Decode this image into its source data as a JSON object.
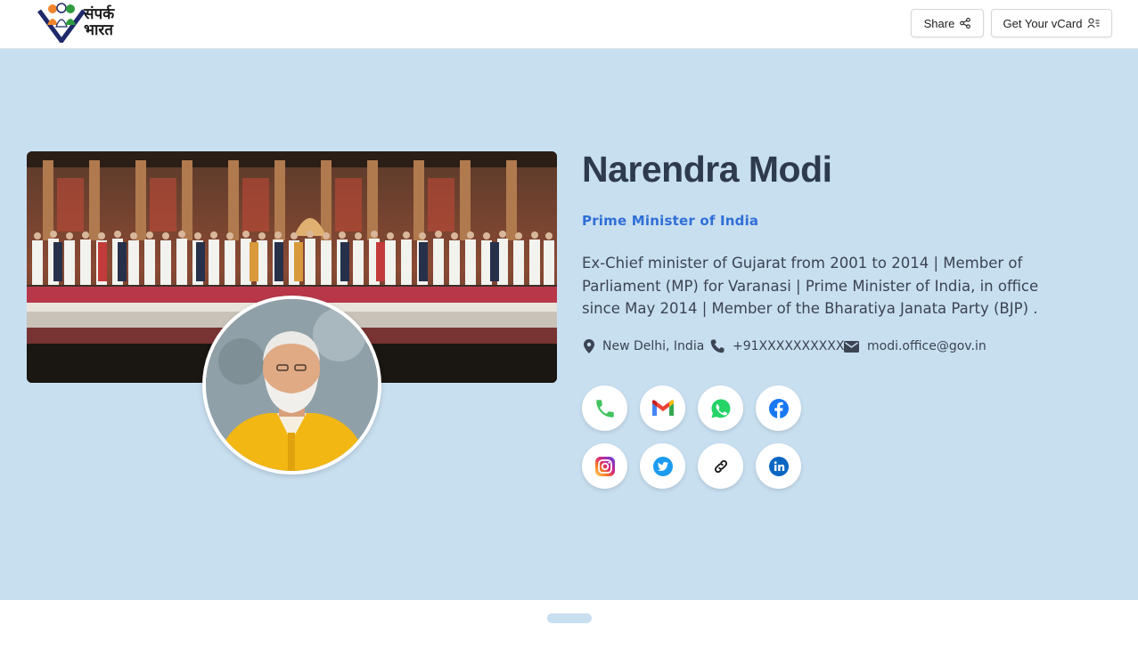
{
  "header": {
    "logo_text": "संपर्क\nभारत",
    "share_label": "Share",
    "vcard_label": "Get Your vCard"
  },
  "profile": {
    "name": "Narendra Modi",
    "title": "Prime Minister of India",
    "bio": "Ex-Chief minister of Gujarat from 2001 to 2014 | Member of Parliament (MP) for Varanasi | Prime Minister of India, in office since May 2014 | Member of the Bharatiya Janata Party (BJP) .",
    "location": "New Delhi, India",
    "phone": "+91XXXXXXXXXX",
    "email": "modi.office@gov.in"
  },
  "social": [
    "phone-icon",
    "gmail-icon",
    "whatsapp-icon",
    "facebook-icon",
    "instagram-icon",
    "twitter-icon",
    "link-icon",
    "linkedin-icon"
  ],
  "colors": {
    "hero_bg": "#c8dff0",
    "accent": "#2f6fd6",
    "name": "#2e3a4d"
  }
}
